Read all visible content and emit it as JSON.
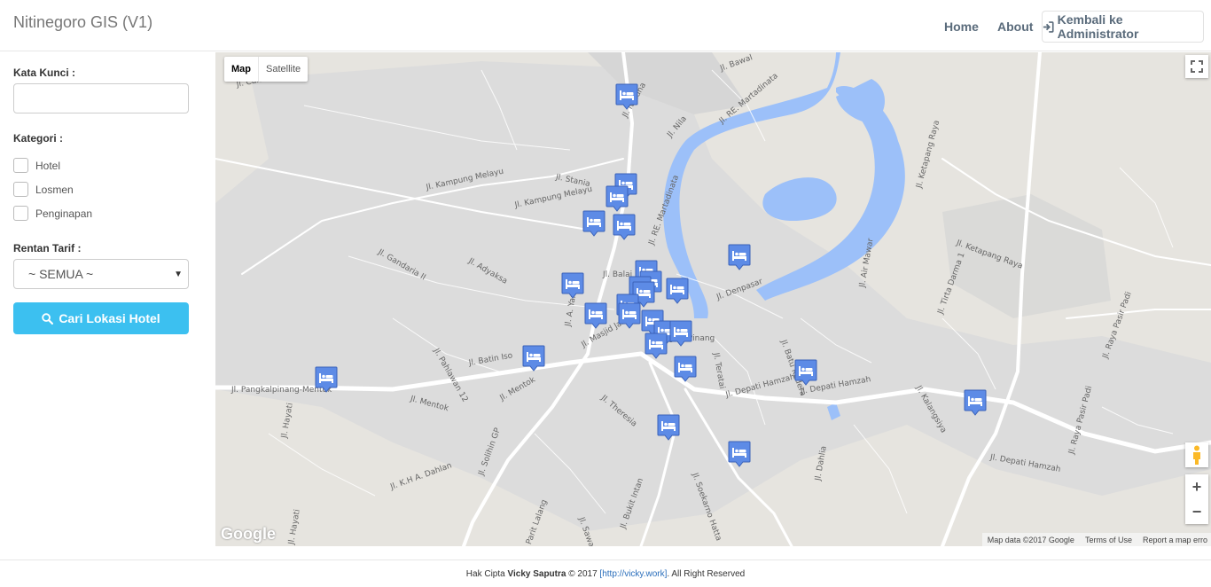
{
  "app": {
    "title": "Nitinegoro GIS (V1)"
  },
  "nav": {
    "home": "Home",
    "about": "About",
    "admin": "Kembali ke Administrator"
  },
  "sidebar": {
    "keyword_label": "Kata Kunci :",
    "keyword_value": "",
    "category_label": "Kategori :",
    "categories": [
      "Hotel",
      "Losmen",
      "Penginapan"
    ],
    "rate_label": "Rentan Tarif :",
    "rate_selected": "~ SEMUA ~",
    "search_button": "Cari Lokasi Hotel"
  },
  "map": {
    "type_map": "Map",
    "type_satellite": "Satellite",
    "google": "Google",
    "attribution": {
      "data": "Map data ©2017 Google",
      "terms": "Terms of Use",
      "report": "Report a map erro"
    },
    "zoom_in": "+",
    "zoom_out": "−",
    "streets": [
      "Jl. Bawal",
      "Jl. Candrawasih",
      "Jl. Natuna",
      "Jl. RE. Martadinata",
      "Jl. Nila",
      "Jl. Stania",
      "Jl. Kampung Melayu",
      "Jl. Kampung Melayu",
      "Jl. RE. Martadinata",
      "Jl. Gandaria II",
      "Jl. Adyaksa",
      "Jl. Balai",
      "Jl. A. Yani",
      "Jl. Masjid Jamik",
      "Jl. Batin Iso",
      "Jl. Mentok",
      "Jl. Mentok",
      "Jl. Pahlawan 12",
      "Jl. Pangkalpinang-Mentok",
      "Jl. Hayati",
      "Jl. Theresia",
      "Jl. Solihin GP",
      "Jl. K.H A. Dahlan",
      "Jl. Hayati",
      "Jl. Parit Lalang",
      "Jl. Sawah",
      "Jl. Bukit Intan",
      "Jl. Soekarno Hatta",
      "Jl. Depati Hamzah",
      "Jl. Depati Hamzah",
      "Jl. Depati Hamzah",
      "Jl. Denpasar",
      "Jl. Batu Kadera",
      "Jl. Teratai",
      "Jl. Air Mawar",
      "Jl. Ketapang Raya",
      "Jl. Ketapang Raya",
      "Jl. Tirta Darma 1",
      "Jl. Raya Pasir Padi",
      "Jl. Raya Pasir Padi",
      "Jl. Kalangsiya",
      "Jl. Dahlia",
      "Pangkal Pinang"
    ],
    "marker_icon": "hotel-bed-icon"
  },
  "footer": {
    "prefix": "Hak Cipta",
    "author": "Vicky Saputra",
    "year": "© 2017",
    "url": "[http://vicky.work]",
    "suffix": ". All Right Reserved"
  }
}
